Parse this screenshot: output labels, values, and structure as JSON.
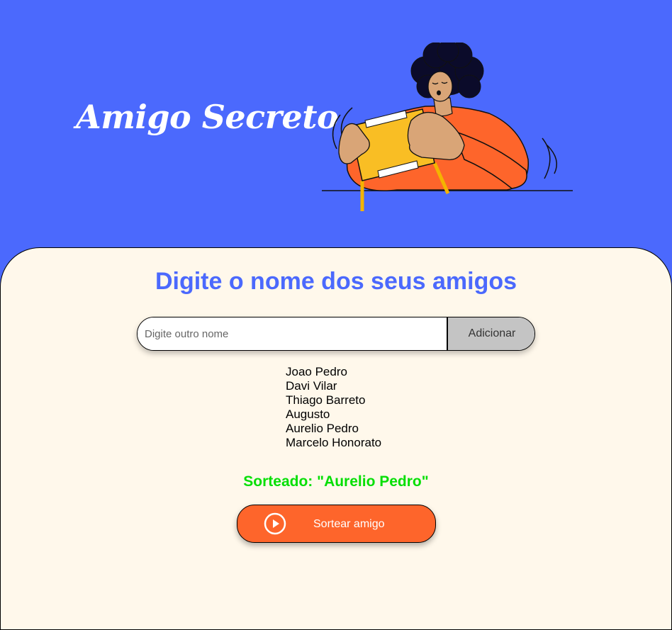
{
  "header": {
    "title": "Amigo Secreto"
  },
  "illustration": {
    "name": "person-with-gift-illustration"
  },
  "main": {
    "heading": "Digite o nome dos seus amigos",
    "input": {
      "placeholder": "Digite outro nome",
      "value": ""
    },
    "add_button_label": "Adicionar",
    "friends": [
      "Joao Pedro",
      "Davi Vilar",
      "Thiago Barreto",
      "Augusto",
      "Aurelio Pedro",
      "Marcelo Honorato"
    ],
    "result_text": "Sorteado: \"Aurelio Pedro\"",
    "draw_button_label": "Sortear amigo",
    "draw_button_icon": "play-circle-icon"
  },
  "colors": {
    "header_bg": "#4B69FD",
    "main_bg": "#FFF8EB",
    "accent_orange": "#FE652B",
    "result_green": "#05DF05",
    "add_button_bg": "#C4C4C4"
  }
}
